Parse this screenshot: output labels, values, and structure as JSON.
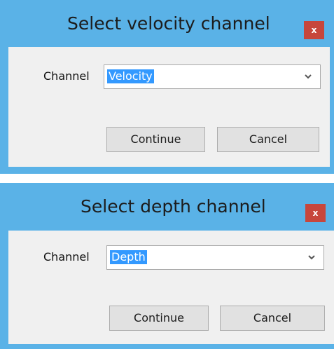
{
  "dialogs": [
    {
      "title": "Select velocity channel",
      "close_label": "x",
      "channel_label": "Channel",
      "channel_value": "Velocity",
      "continue_label": "Continue",
      "cancel_label": "Cancel"
    },
    {
      "title": "Select depth channel",
      "close_label": "x",
      "channel_label": "Channel",
      "channel_value": "Depth",
      "continue_label": "Continue",
      "cancel_label": "Cancel"
    }
  ],
  "colors": {
    "frame": "#5ab2e7",
    "close_button": "#c7463c",
    "selection": "#3399ff",
    "client_background": "#f0f0f0"
  },
  "icons": {
    "close": "close-icon",
    "dropdown": "chevron-down-icon"
  }
}
